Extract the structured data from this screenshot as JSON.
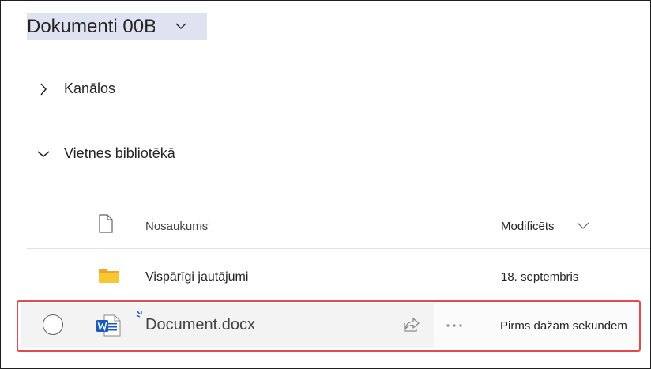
{
  "library": {
    "title": "Dokumenti 00B",
    "icons": {
      "title_dropdown": "chevron-down-icon"
    }
  },
  "sections": {
    "channels": {
      "label": "Kanālos",
      "state": "collapsed",
      "icon": "chevron-right-icon"
    },
    "site_library": {
      "label": "Vietnes bibliotēkā",
      "state": "expanded",
      "icon": "chevron-down-icon"
    }
  },
  "columns": {
    "file_type_icon": "file-icon",
    "name_header": "Nosaukums",
    "modified_header": "Modificēts"
  },
  "rows": [
    {
      "type": "folder",
      "icon": "folder-icon",
      "name": "Vispārīgi jautājumi",
      "modified": "18. septembris"
    },
    {
      "type": "word-document",
      "icon": "word-doc-icon",
      "badge_icon": "new-sparkle-icon",
      "name": "Document.docx",
      "modified": "Pirms dažām sekundēm",
      "highlighted": true,
      "actions": [
        "share-icon",
        "more-options-icon"
      ]
    }
  ],
  "colors": {
    "title_highlight": "#dfe3f1",
    "folder": "#f8c631",
    "word_blue": "#185abd",
    "selection_outline": "#e24a4f",
    "row_hover": "#f3f3f3"
  }
}
